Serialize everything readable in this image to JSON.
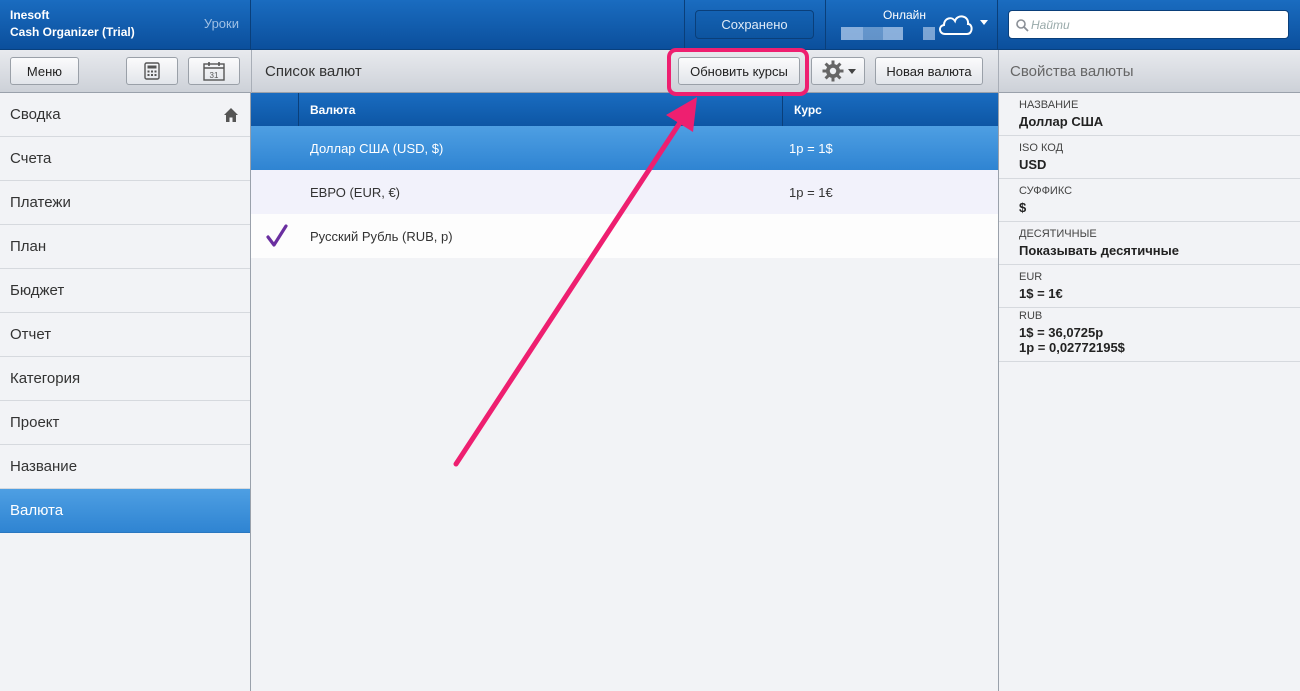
{
  "app": {
    "company": "Inesoft",
    "product": "Cash Organizer (Trial)",
    "lessons_label": "Уроки"
  },
  "topbar": {
    "saved_label": "Сохранено",
    "online_label": "Онлайн",
    "search_placeholder": "Найти",
    "cloud_icon": "cloud-icon",
    "search_icon": "search-icon"
  },
  "toolbar": {
    "menu_label": "Меню",
    "calculator_icon": "calculator-icon",
    "calendar_icon": "calendar-icon",
    "calendar_day": "31",
    "list_title": "Список валют",
    "update_rates_label": "Обновить курсы",
    "settings_icon": "gear-icon",
    "new_currency_label": "Новая валюта",
    "properties_title": "Свойства валюты"
  },
  "sidebar": {
    "items": [
      {
        "label": "Сводка",
        "icon": "home-icon"
      },
      {
        "label": "Счета"
      },
      {
        "label": "Платежи"
      },
      {
        "label": "План"
      },
      {
        "label": "Бюджет"
      },
      {
        "label": "Отчет"
      },
      {
        "label": "Категория"
      },
      {
        "label": "Проект"
      },
      {
        "label": "Название"
      },
      {
        "label": "Валюта",
        "active": true
      }
    ]
  },
  "currency_list": {
    "columns": [
      "Валюта",
      "Курс"
    ],
    "rows": [
      {
        "name": "Доллар США (USD, $)",
        "rate": "1р = 1$",
        "selected": true,
        "base": false
      },
      {
        "name": "ЕВРО (EUR, €)",
        "rate": "1р = 1€",
        "selected": false,
        "base": false
      },
      {
        "name": "Русский Рубль (RUB, р)",
        "rate": "",
        "selected": false,
        "base": true
      }
    ]
  },
  "properties": {
    "name_label": "НАЗВАНИЕ",
    "name_value": "Доллар США",
    "iso_label": "ISO КОД",
    "iso_value": "USD",
    "suffix_label": "СУФФИКС",
    "suffix_value": "$",
    "decimals_label": "ДЕСЯТИЧНЫЕ",
    "decimals_value": "Показывать десятичные",
    "eur_label": "EUR",
    "eur_value": "1$ = 1€",
    "rub_label": "RUB",
    "rub_value_1": "1$ = 36,0725р",
    "rub_value_2": "1р = 0,02772195$"
  },
  "colors": {
    "accent_blue": "#1a6cc0",
    "selection_blue": "#3f92dc",
    "annotation_pink": "#ee1f70",
    "check_purple": "#6a2fa0"
  }
}
